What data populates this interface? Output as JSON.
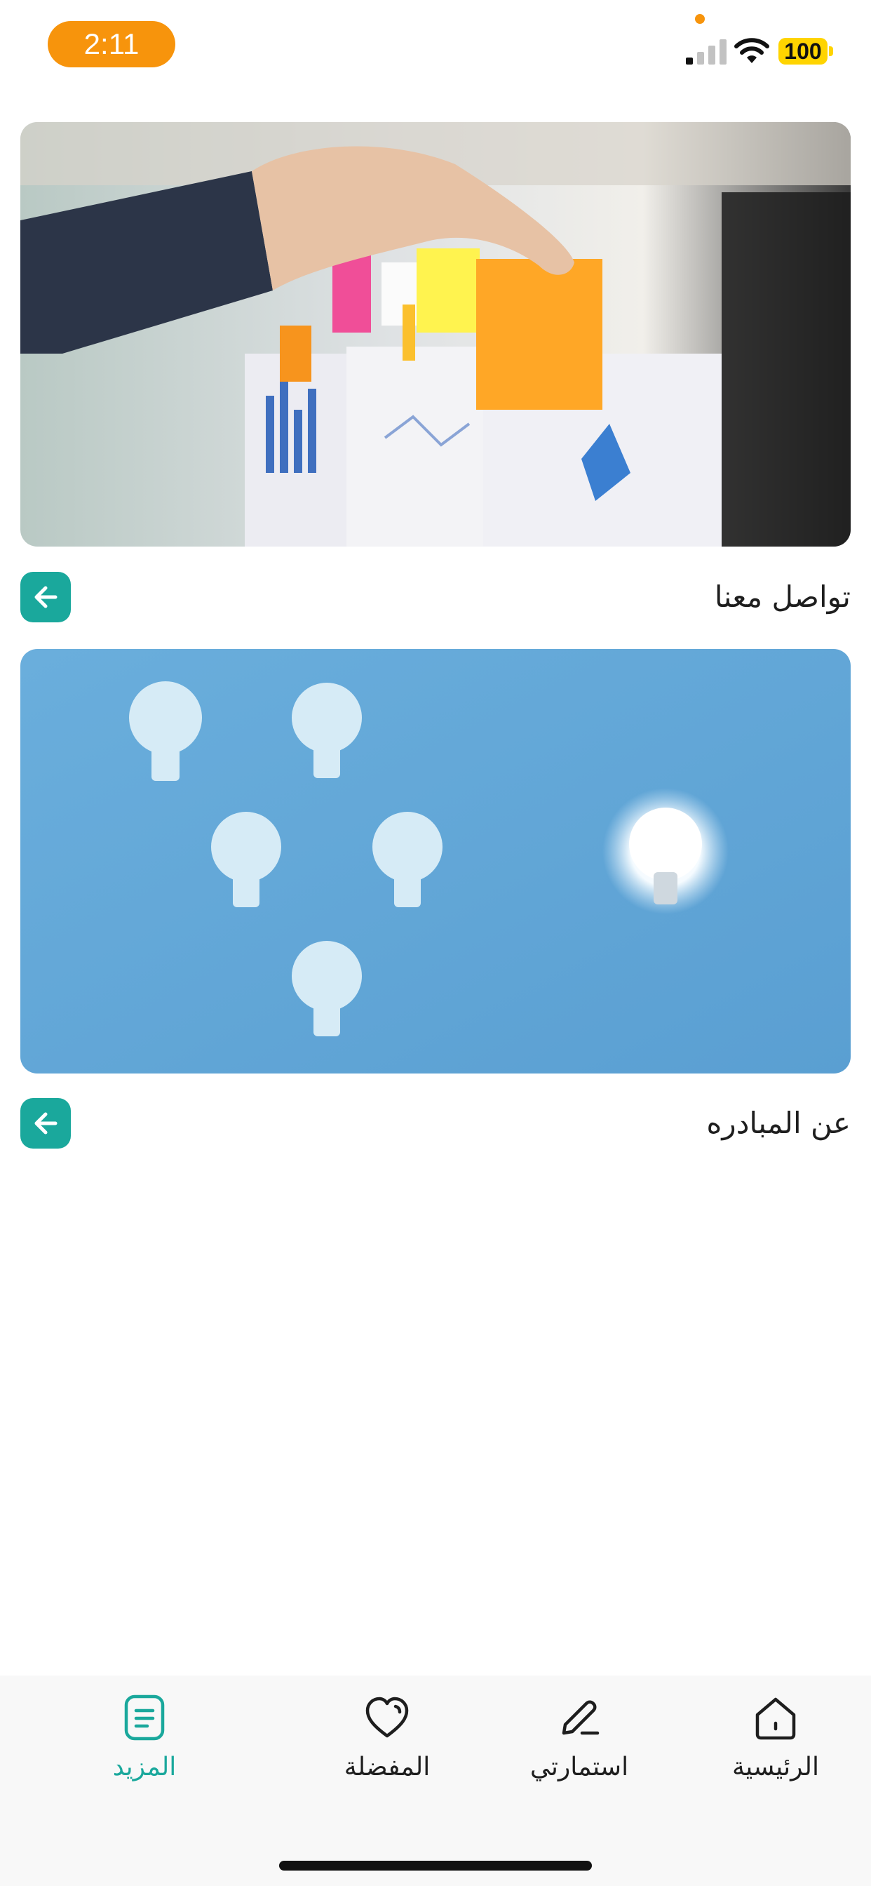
{
  "status_bar": {
    "time": "2:11",
    "battery_level": "100",
    "accent_color": "#f7940c"
  },
  "cards": [
    {
      "title": "تواصل معنا",
      "image": "hand-placing-sticky-notes-on-charts",
      "action_icon": "arrow-left-icon"
    },
    {
      "title": "عن المبادره",
      "image": "light-bulbs-on-blue-background",
      "action_icon": "arrow-left-icon"
    }
  ],
  "tab_bar": {
    "items": [
      {
        "label": "الرئيسية",
        "icon": "home-icon",
        "active": false
      },
      {
        "label": "استمارتي",
        "icon": "pencil-icon",
        "active": false
      },
      {
        "label": "المفضلة",
        "icon": "heart-icon",
        "active": false
      },
      {
        "label": "المزيد",
        "icon": "list-icon",
        "active": true
      }
    ]
  },
  "colors": {
    "accent": "#1aa89c",
    "tab_bar_background": "#f8f8f8",
    "text": "#1e1e1e"
  }
}
